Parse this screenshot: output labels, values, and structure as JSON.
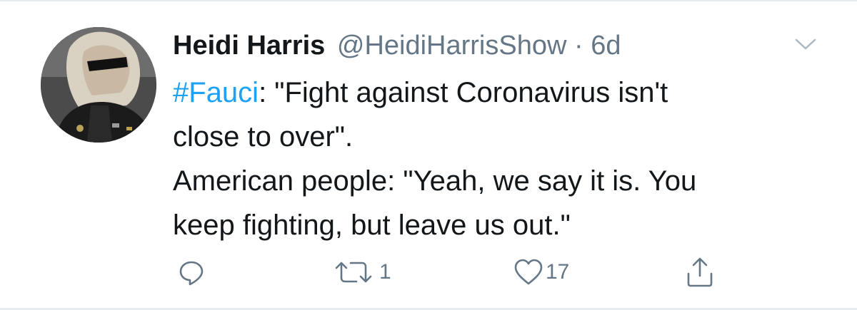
{
  "tweet": {
    "display_name": "Heidi Harris",
    "handle": "@HeidiHarrisShow",
    "separator": "·",
    "time": "6d",
    "body": {
      "hashtag": "#Fauci",
      "line1_rest": ": \"Fight against Coronavirus isn't",
      "line2": "close to over\".",
      "line3": "American people: \"Yeah, we say it is. You",
      "line4": "keep fighting, but leave us out.\""
    }
  },
  "actions": {
    "reply_icon": "reply-icon",
    "retweet_icon": "retweet-icon",
    "retweet_count": "1",
    "like_icon": "heart-icon",
    "like_count": "17",
    "share_icon": "share-icon"
  },
  "menu": {
    "icon": "chevron-down-icon"
  },
  "colors": {
    "hashtag": "#1da1f2",
    "secondary_text": "#657786",
    "primary_text": "#14171a",
    "divider": "#e6ecf0"
  }
}
